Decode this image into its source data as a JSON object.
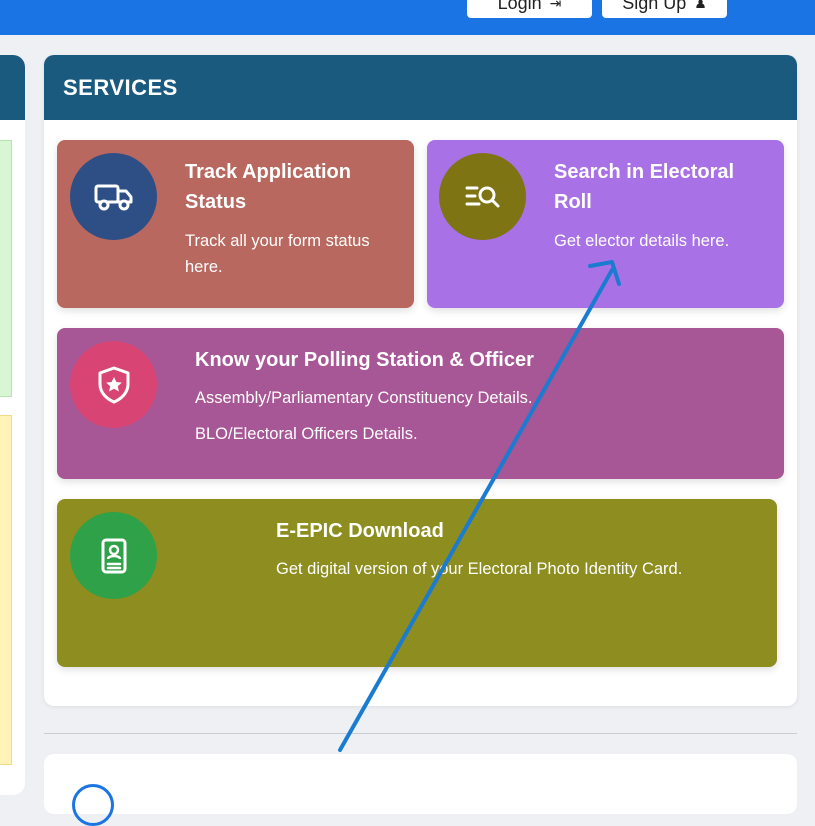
{
  "header": {
    "login_label": "Login",
    "login_icon": "sign-in-icon",
    "signup_label": "Sign Up",
    "signup_icon": "user-icon"
  },
  "services": {
    "title": "SERVICES",
    "cards": [
      {
        "title": "Track Application Status",
        "description": "Track all your form status here.",
        "icon": "truck-icon",
        "color": "#b8685f",
        "icon_color": "#2e4f86"
      },
      {
        "title": "Search in Electoral Roll",
        "description": "Get elector details here.",
        "icon": "search-list-icon",
        "color": "#a872e6",
        "icon_color": "#7e7414"
      },
      {
        "title": "Know your Polling Station & Officer",
        "description_1": "Assembly/Parliamentary Constituency Details.",
        "description_2": "BLO/Electoral Officers Details.",
        "icon": "shield-star-icon",
        "color": "#a75696",
        "icon_color": "#d84575"
      },
      {
        "title": "E-EPIC Download",
        "description": "Get digital version of your Electoral Photo Identity Card.",
        "icon": "id-card-icon",
        "color": "#8d8d20",
        "icon_color": "#2fa148"
      }
    ]
  },
  "colors": {
    "topbar": "#1b74e4",
    "services_header": "#1a5a7e",
    "annotation_arrow": "#1a7bd1"
  }
}
